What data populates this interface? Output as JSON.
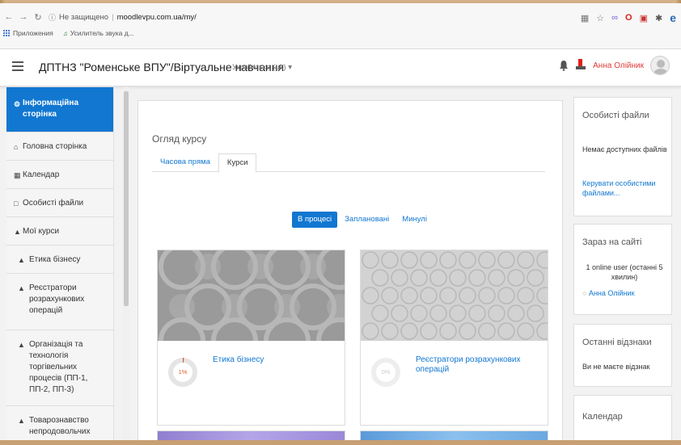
{
  "browser": {
    "security_label": "Не защищено",
    "url": "moodlevpu.com.ua/my/",
    "bookmarks": [
      {
        "label": "Приложения"
      },
      {
        "label": "Усилитель звука д..."
      }
    ]
  },
  "navbar": {
    "site_title": "ДПТНЗ \"Роменське ВПУ\"/Віртуальне навчання",
    "language": "Українська (uk) ▾",
    "user_name": "Анна Олійник"
  },
  "sidebar": {
    "items": [
      {
        "label": "Інформаційна сторінка",
        "icon": "dashboard-icon",
        "active": true
      },
      {
        "label": "Головна сторінка",
        "icon": "home-icon"
      },
      {
        "label": "Календар",
        "icon": "calendar-icon"
      },
      {
        "label": "Особисті файли",
        "icon": "file-icon"
      },
      {
        "label": "Мої курси",
        "icon": "graduation-cap-icon"
      },
      {
        "label": "Етика бізнесу",
        "icon": "graduation-cap-icon",
        "sub": true
      },
      {
        "label": "Реєстратори розрахункових операцій",
        "icon": "graduation-cap-icon",
        "sub": true
      },
      {
        "label": "Організація та технологія торгівельних процесів (ПП-1, ПП-2, ПП-3)",
        "icon": "graduation-cap-icon",
        "sub": true
      },
      {
        "label": "Товарознавство непродовольчих",
        "icon": "graduation-cap-icon",
        "sub": true
      }
    ]
  },
  "course_overview": {
    "title": "Огляд курсу",
    "tabs": [
      "Часова пряма",
      "Курси"
    ],
    "filters": [
      "В процесі",
      "Заплановані",
      "Минулі"
    ],
    "courses": [
      {
        "name": "Етика бізнесу",
        "progress_percent": 1,
        "progress_label": "1%"
      },
      {
        "name": "Реєстратори розрахункових операцій",
        "progress_percent": 0,
        "progress_label": "0%"
      }
    ]
  },
  "blocks": {
    "private_files": {
      "title": "Особисті файли",
      "empty": "Немає доступних файлів",
      "manage_link": "Керувати особистими файлами..."
    },
    "online_users": {
      "title": "Зараз на сайті",
      "summary": "1 online user (останні 5 хвилин)",
      "user": "Анна Олійник"
    },
    "recent_badges": {
      "title": "Останні відзнаки",
      "empty": "Ви не маєте відзнак"
    },
    "calendar": {
      "title": "Календар"
    }
  },
  "colors": {
    "accent": "#1177d1",
    "progress": "#e05a2a",
    "user_name": "#e03a3a"
  }
}
